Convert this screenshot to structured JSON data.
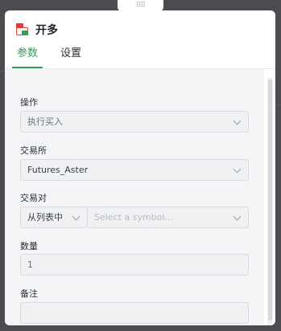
{
  "header": {
    "title": "开多"
  },
  "tabs": [
    {
      "label": "参数",
      "active": true
    },
    {
      "label": "设置",
      "active": false
    }
  ],
  "form": {
    "operation": {
      "label": "操作",
      "value": "执行买入"
    },
    "exchange": {
      "label": "交易所",
      "value": "Futures_Aster"
    },
    "pair": {
      "label": "交易对",
      "source_value": "从列表中",
      "symbol_placeholder": "Select a symbol..."
    },
    "quantity": {
      "label": "数量",
      "value": "1"
    },
    "note": {
      "label": "备注",
      "value": ""
    }
  },
  "colors": {
    "accent": "#2e9e58",
    "icon_red": "#e53935"
  },
  "icons": {
    "drag_handle": "drag-handle-icon",
    "app": "app-icon",
    "chevron": "chevron-down-icon"
  }
}
